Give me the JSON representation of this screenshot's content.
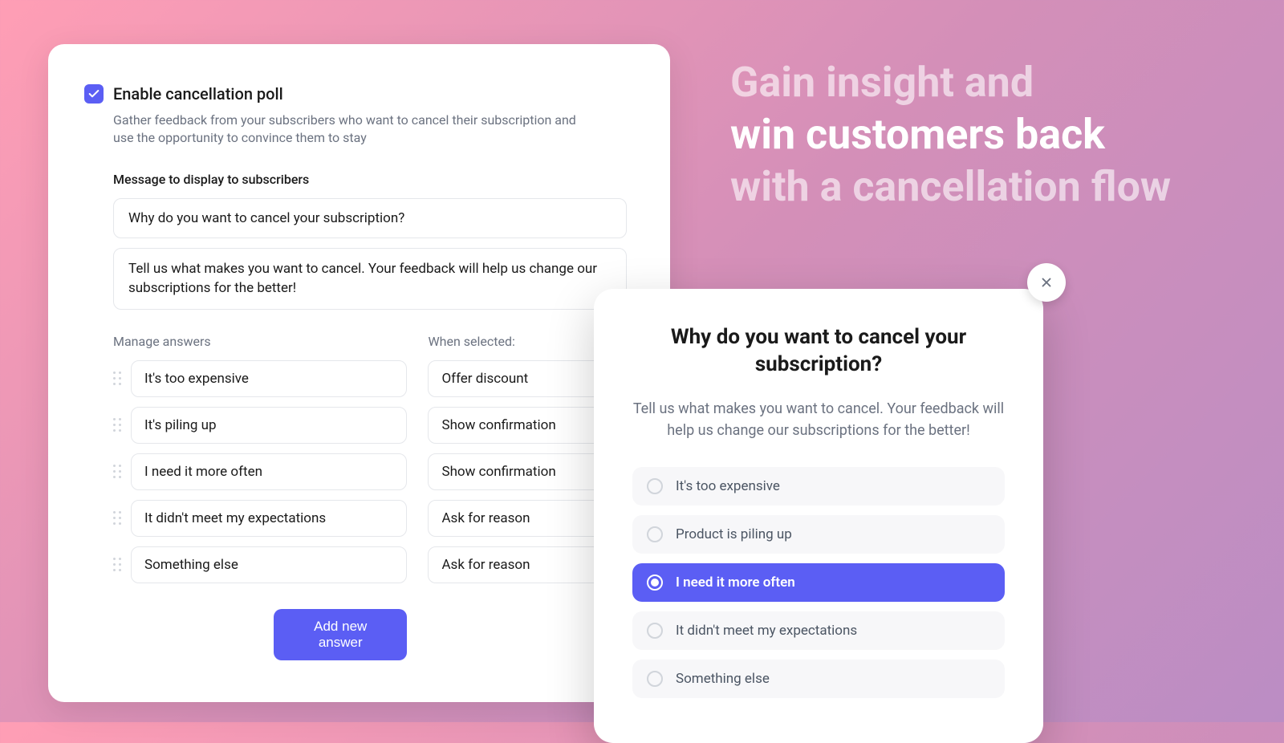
{
  "panel": {
    "enable_label": "Enable cancellation poll",
    "description": "Gather feedback from your subscribers who want to cancel their subscription and use the opportunity to convince them to stay",
    "message_label": "Message to display to subscribers",
    "message_title": "Why do you want to cancel your subscription?",
    "message_body": "Tell us what makes you want to cancel. Your feedback will help us change our  subscriptions for the better!",
    "manage_answers_label": "Manage answers",
    "when_selected_label": "When selected:",
    "answers": [
      {
        "text": "It's too expensive",
        "action": "Offer discount"
      },
      {
        "text": "It's piling up",
        "action": "Show confirmation"
      },
      {
        "text": "I need it more often",
        "action": "Show confirmation"
      },
      {
        "text": "It didn't meet my expectations",
        "action": "Ask for reason"
      },
      {
        "text": "Something else",
        "action": "Ask for reason"
      }
    ],
    "add_button": "Add new answer"
  },
  "headline": {
    "line1": "Gain insight and",
    "line2": "win customers back",
    "line3": "with a cancellation flow"
  },
  "modal": {
    "title": "Why do you want to cancel your subscription?",
    "subtitle": "Tell us what makes you want to cancel. Your feedback will help us change our subscriptions for the better!",
    "options": [
      {
        "label": "It's too expensive",
        "selected": false
      },
      {
        "label": "Product is piling up",
        "selected": false
      },
      {
        "label": "I need it more often",
        "selected": true
      },
      {
        "label": "It didn't meet my expectations",
        "selected": false
      },
      {
        "label": "Something else",
        "selected": false
      }
    ]
  }
}
